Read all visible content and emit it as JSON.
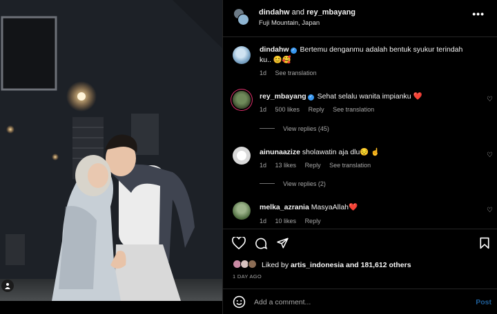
{
  "header": {
    "user1": "dindahw",
    "and_text": "and",
    "user2": "rey_mbayang",
    "location": "Fuji Mountain, Japan",
    "more_icon": "more-horizontal-icon"
  },
  "comments": [
    {
      "user": "dindahw",
      "verified": true,
      "text": "Bertemu denganmu adalah bentuk syukur terindah ku.. 😊🥰",
      "time": "1d",
      "likes": "",
      "reply": "",
      "translate": "See translation"
    },
    {
      "user": "rey_mbayang",
      "verified": true,
      "text": "Sehat selalu wanita impianku ❤️",
      "time": "1d",
      "likes": "500 likes",
      "reply": "Reply",
      "translate": "See translation",
      "view_replies": "View replies (45)"
    },
    {
      "user": "ainunaazize",
      "verified": false,
      "text": "sholawatin aja dlu😔 ☝️",
      "time": "1d",
      "likes": "13 likes",
      "reply": "Reply",
      "translate": "See translation",
      "view_replies": "View replies (2)"
    },
    {
      "user": "melka_azrania",
      "verified": false,
      "text": "MasyaAllah❤️",
      "time": "1d",
      "likes": "10 likes",
      "reply": "Reply",
      "translate": ""
    }
  ],
  "likes": {
    "prefix": "Liked by",
    "user": "artis_indonesia",
    "suffix": "and 181,612 others"
  },
  "time_ago": "1 DAY AGO",
  "add_comment": {
    "placeholder": "Add a comment...",
    "post_label": "Post"
  },
  "colors": {
    "background": "#000000",
    "verified": "#3897f0",
    "heart_red": "#ed4956",
    "post_button": "#1f5f99"
  }
}
